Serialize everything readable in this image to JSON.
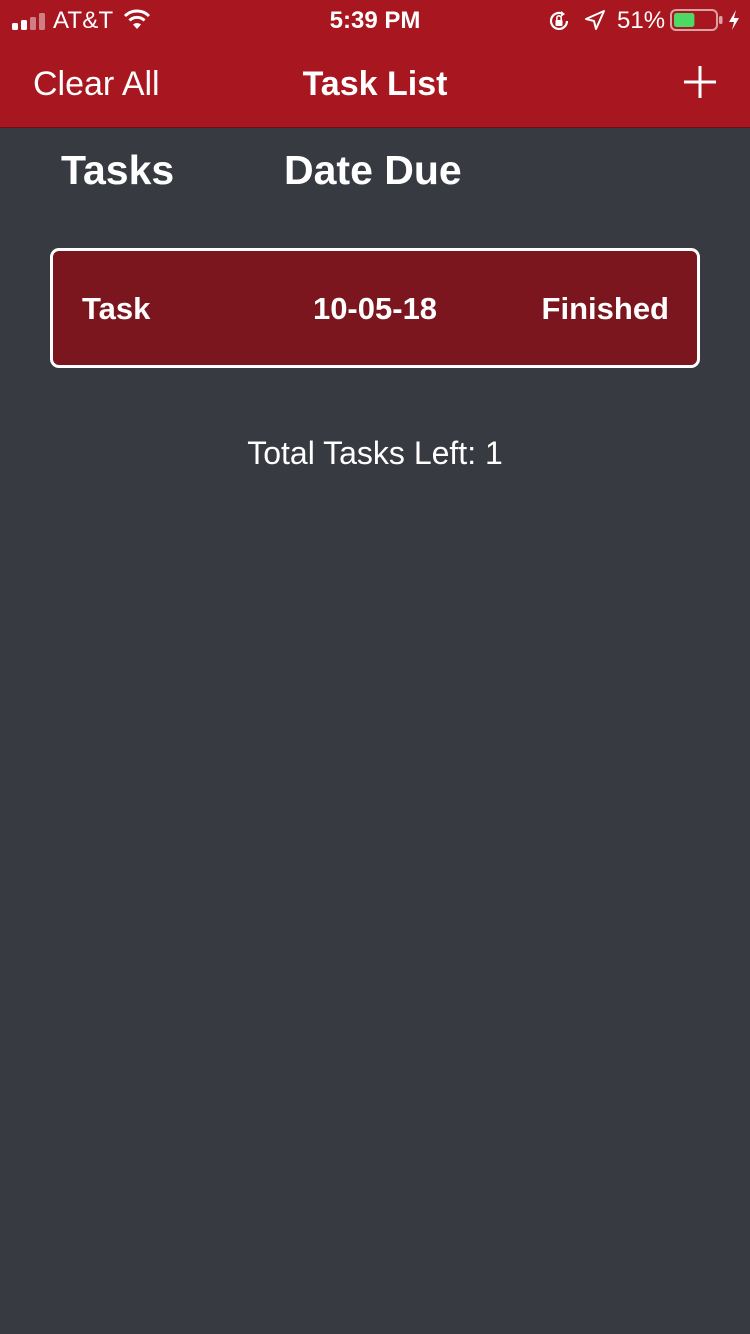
{
  "status_bar": {
    "carrier": "AT&T",
    "time": "5:39 PM",
    "battery_percent": "51%",
    "battery_level": 0.51,
    "signal_bars": 2,
    "icons": [
      "signal-icon",
      "wifi-icon",
      "orientation-lock-icon",
      "location-icon",
      "battery-icon",
      "charging-icon"
    ]
  },
  "nav": {
    "left_button": "Clear All",
    "title": "Task List",
    "right_icon": "plus-icon"
  },
  "columns": {
    "tasks": "Tasks",
    "date_due": "Date Due"
  },
  "tasks": [
    {
      "name": "Task",
      "date": "10-05-18",
      "status": "Finished"
    }
  ],
  "summary": {
    "total_left": "Total Tasks Left: 1"
  },
  "colors": {
    "header_red": "#a8161f",
    "row_red": "#7b161e",
    "background": "#383a42",
    "battery_green": "#4cd964"
  }
}
